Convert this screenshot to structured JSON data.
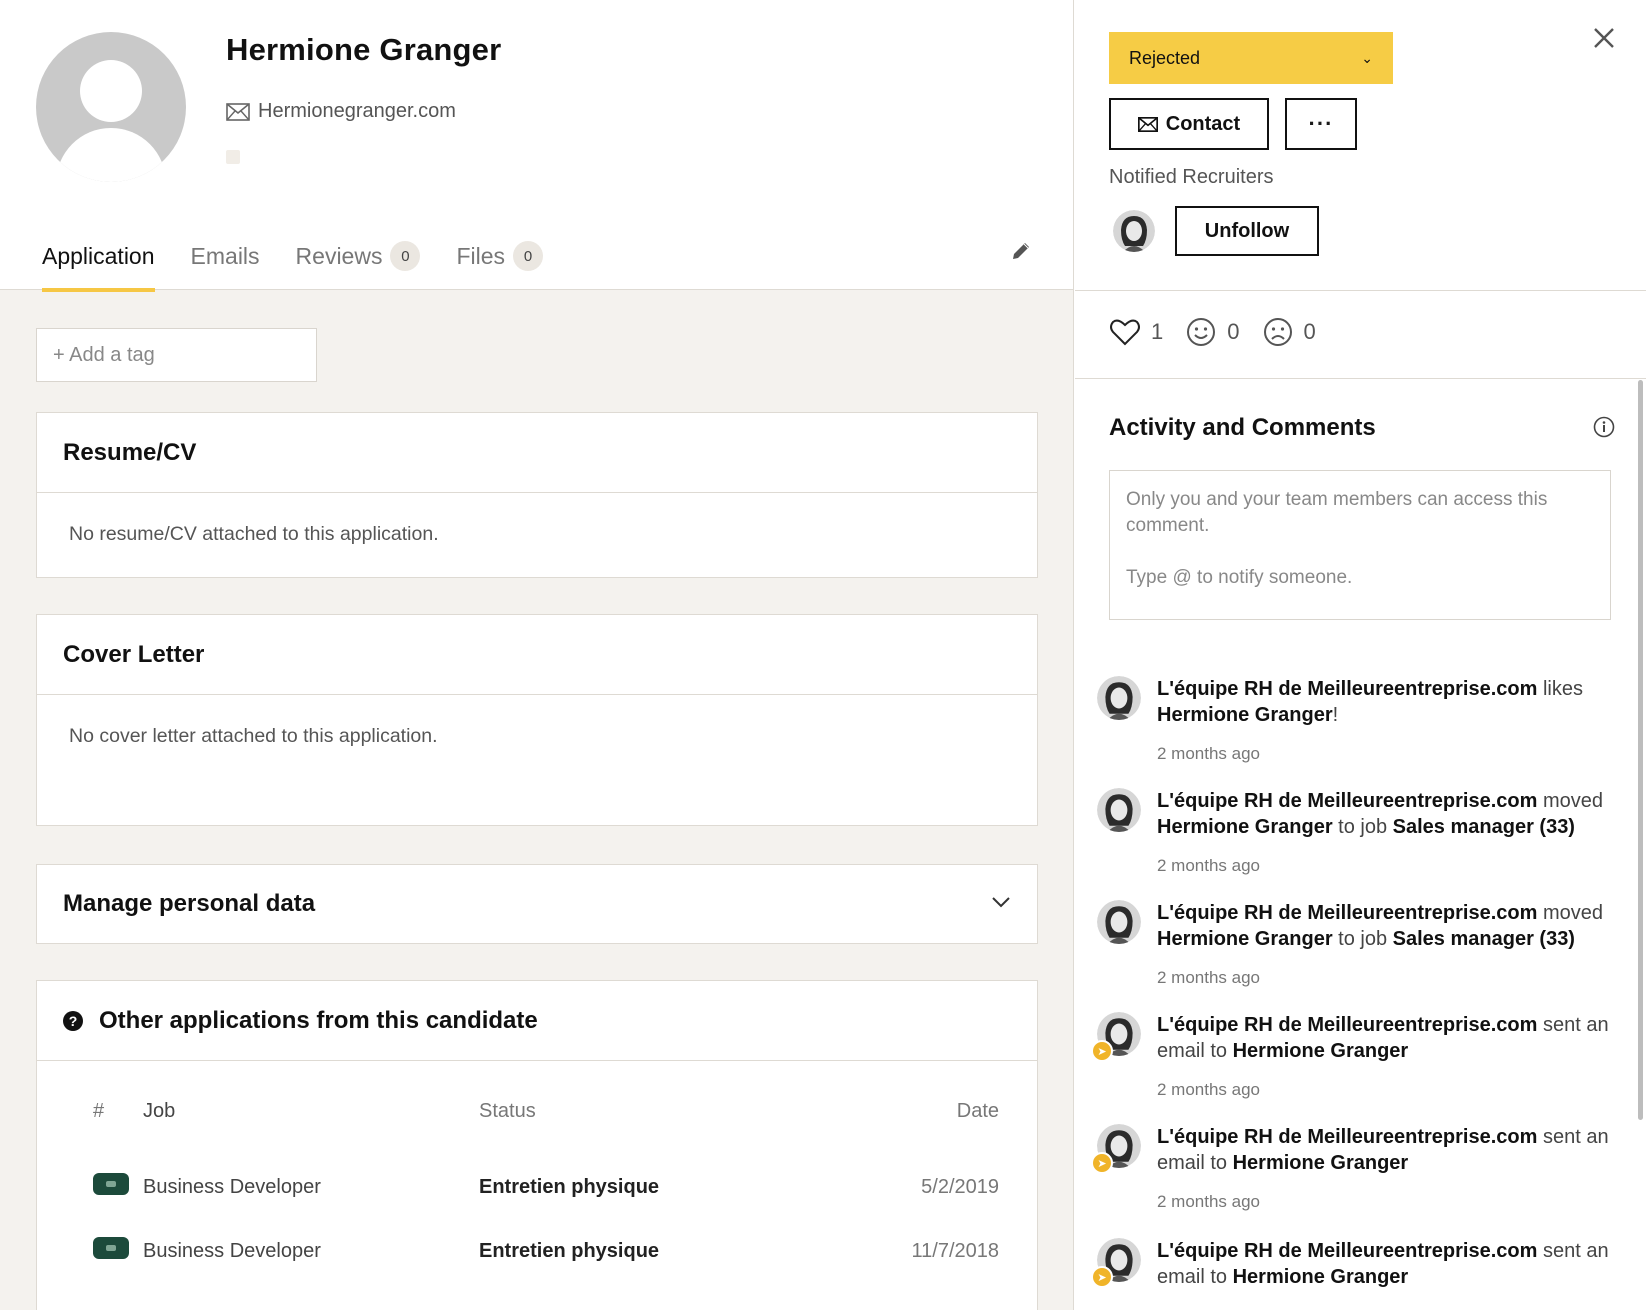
{
  "candidate": {
    "name": "Hermione Granger",
    "email": "Hermionegranger.com"
  },
  "tabs": [
    {
      "label": "Application",
      "count": null,
      "active": true
    },
    {
      "label": "Emails",
      "count": null,
      "active": false
    },
    {
      "label": "Reviews",
      "count": "0",
      "active": false
    },
    {
      "label": "Files",
      "count": "0",
      "active": false
    }
  ],
  "tag": {
    "placeholder": "+ Add a tag"
  },
  "sections": {
    "resume": {
      "title": "Resume/CV",
      "body": "No resume/CV attached to this application."
    },
    "cover": {
      "title": "Cover Letter",
      "body": "No cover letter attached to this application."
    },
    "personal": {
      "title": "Manage personal data"
    },
    "other_apps": {
      "title": "Other applications from this candidate",
      "headers": {
        "num": "#",
        "job": "Job",
        "status": "Status",
        "date": "Date"
      },
      "rows": [
        {
          "job": "Business Developer",
          "status": "Entretien physique",
          "date": "5/2/2019"
        },
        {
          "job": "Business Developer",
          "status": "Entretien physique",
          "date": "11/7/2018"
        }
      ]
    }
  },
  "sidebar": {
    "status": "Rejected",
    "contact_label": "Contact",
    "more_label": "···",
    "notified_label": "Notified Recruiters",
    "unfollow_label": "Unfollow",
    "reactions": {
      "likes": "1",
      "smiles": "0",
      "frowns": "0"
    },
    "activity_title": "Activity and Comments",
    "comment_placeholder_1": "Only you and your team members can access this comment.",
    "comment_placeholder_2": "Type @ to notify someone.",
    "accent_color": "#f6cc45"
  },
  "activity": [
    {
      "actor": "L'équipe RH de Meilleureentreprise.com",
      "verb": " likes ",
      "target": "Hermione Granger",
      "suffix": "!",
      "extra": "",
      "job": "",
      "time": "2 months ago",
      "badge": false
    },
    {
      "actor": "L'équipe RH de Meilleureentreprise.com",
      "verb": " moved ",
      "target": "Hermione Granger",
      "suffix": "",
      "extra": " to job ",
      "job": "Sales manager (33)",
      "time": "2 months ago",
      "badge": false
    },
    {
      "actor": "L'équipe RH de Meilleureentreprise.com",
      "verb": " moved ",
      "target": "Hermione Granger",
      "suffix": "",
      "extra": " to job ",
      "job": "Sales manager (33)",
      "time": "2 months ago",
      "badge": false
    },
    {
      "actor": "L'équipe RH de Meilleureentreprise.com",
      "verb": " sent an email to ",
      "target": "Hermione Granger",
      "suffix": "",
      "extra": "",
      "job": "",
      "time": "2 months ago",
      "badge": true
    },
    {
      "actor": "L'équipe RH de Meilleureentreprise.com",
      "verb": " sent an email to ",
      "target": "Hermione Granger",
      "suffix": "",
      "extra": "",
      "job": "",
      "time": "2 months ago",
      "badge": true
    },
    {
      "actor": "L'équipe RH de Meilleureentreprise.com",
      "verb": " sent an email to ",
      "target": "Hermione Granger",
      "suffix": "",
      "extra": "",
      "job": "",
      "time": "",
      "badge": true
    }
  ]
}
